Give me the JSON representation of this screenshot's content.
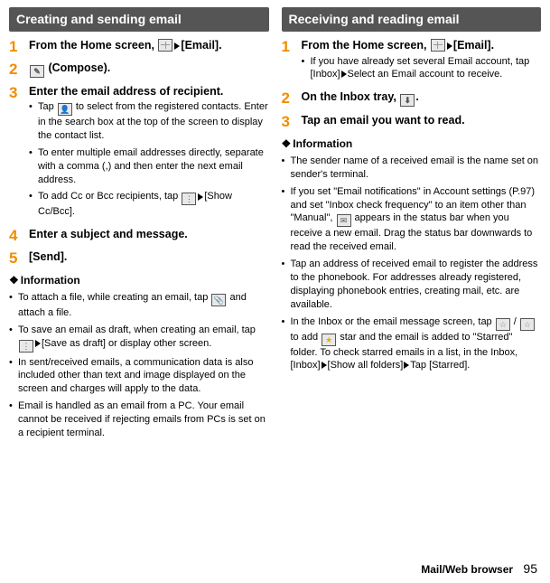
{
  "left": {
    "header": "Creating and sending email",
    "steps": [
      {
        "num": "1",
        "title_parts": [
          "From the Home screen, ",
          "ICON_GRID",
          "TRI",
          "[Email]."
        ],
        "subs": []
      },
      {
        "num": "2",
        "title_parts": [
          "ICON_COMPOSE",
          " (Compose)."
        ],
        "subs": []
      },
      {
        "num": "3",
        "title_parts": [
          "Enter the email address of recipient."
        ],
        "subs": [
          {
            "parts": [
              "Tap ",
              "ICON_CONTACT",
              " to select from the registered contacts. Enter in the search box at the top of the screen to display the contact list."
            ]
          },
          {
            "parts": [
              "To enter multiple email addresses directly, separate with a comma (,) and then enter the next email address."
            ]
          },
          {
            "parts": [
              "To add Cc or Bcc recipients, tap ",
              "ICON_DOTS",
              "TRI",
              "[Show Cc/Bcc]."
            ]
          }
        ]
      },
      {
        "num": "4",
        "title_parts": [
          "Enter a subject and message."
        ],
        "subs": []
      },
      {
        "num": "5",
        "title_parts": [
          "[Send]."
        ],
        "subs": []
      }
    ],
    "info_head": "Information",
    "info": [
      {
        "parts": [
          "To attach a file, while creating an email, tap ",
          "ICON_ATTACH",
          " and attach a file."
        ]
      },
      {
        "parts": [
          "To save an email as draft, when creating an email, tap ",
          "ICON_DOTS",
          "TRI",
          "[Save as draft] or display other screen."
        ]
      },
      {
        "parts": [
          "In sent/received emails, a communication data is also included other than text and image displayed on the screen and charges will apply to the data."
        ]
      },
      {
        "parts": [
          "Email is handled as an email from a PC. Your email cannot be received if rejecting emails from PCs is set on a recipient terminal."
        ]
      }
    ]
  },
  "right": {
    "header": "Receiving and reading email",
    "steps": [
      {
        "num": "1",
        "title_parts": [
          "From the Home screen, ",
          "ICON_GRID",
          "TRI",
          "[Email]."
        ],
        "subs": [
          {
            "parts": [
              "If you have already set several Email account, tap [Inbox]",
              "TRI",
              "Select an Email account to receive."
            ]
          }
        ]
      },
      {
        "num": "2",
        "title_parts": [
          "On the Inbox tray, ",
          "ICON_INBOX",
          "."
        ],
        "subs": []
      },
      {
        "num": "3",
        "title_parts": [
          "Tap an email you want to read."
        ],
        "subs": []
      }
    ],
    "info_head": "Information",
    "info": [
      {
        "parts": [
          "The sender name of a received email is the name set on sender's terminal."
        ]
      },
      {
        "parts": [
          "If you set \"Email notifications\" in Account settings (P.97) and set \"Inbox check frequency\" to an item other than \"Manual\", ",
          "ICON_ENVELOPE",
          " appears in the status bar when you receive a new email. Drag the status bar downwards to read the received email."
        ]
      },
      {
        "parts": [
          "Tap an address of received email to register the address to the phonebook. For addresses already registered, displaying phonebook entries, creating mail, etc. are available."
        ]
      },
      {
        "parts": [
          "In the Inbox or the email message screen, tap ",
          "ICON_STAR_OUTLINE",
          " / ",
          "ICON_STAR_OUTLINE",
          " to add ",
          "ICON_STAR_FILLED",
          " star and the email is added to \"Starred\" folder. To check starred emails in a list, in the Inbox, [Inbox]",
          "TRI",
          "[Show all folders]",
          "TRI",
          "Tap [Starred]."
        ]
      }
    ]
  },
  "footer": {
    "label": "Mail/Web browser",
    "page": "95"
  }
}
